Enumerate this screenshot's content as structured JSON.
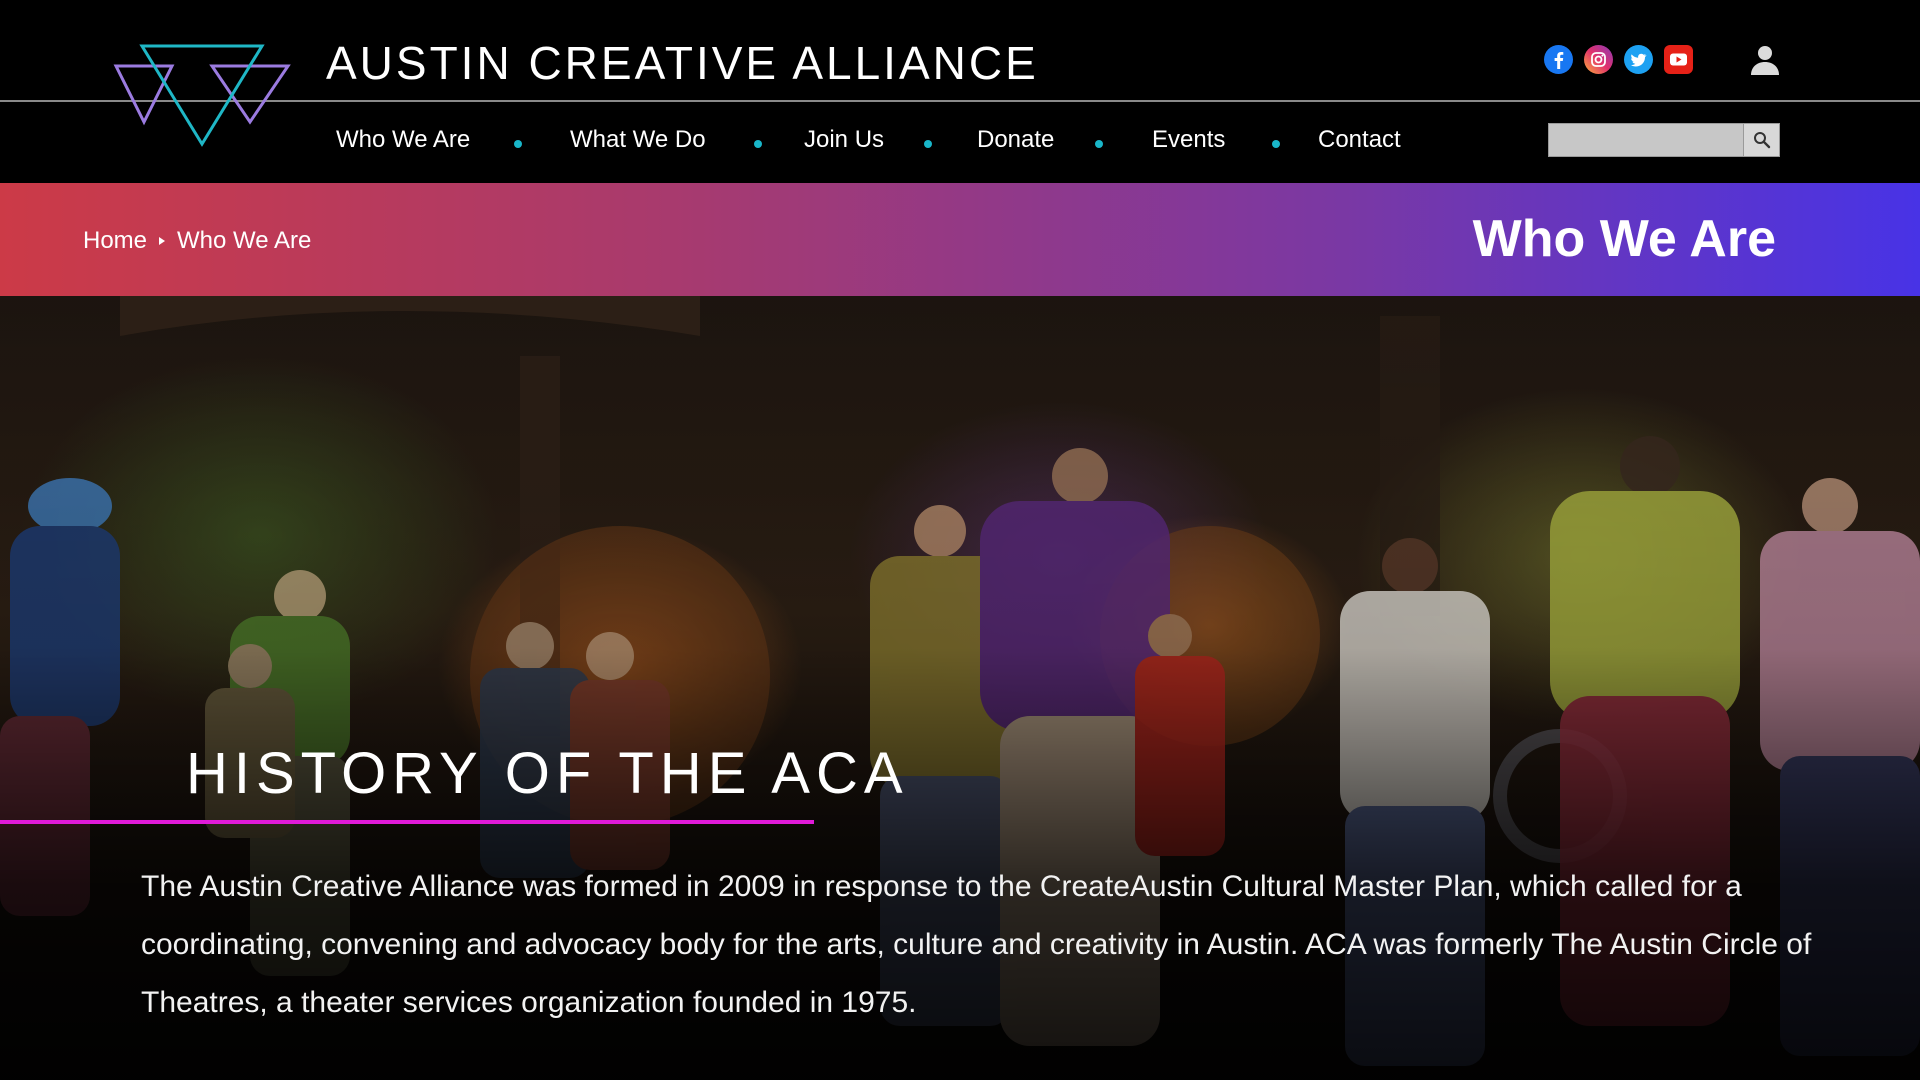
{
  "site": {
    "title": "AUSTIN CREATIVE ALLIANCE",
    "logo_icon": "aca-triangles-logo"
  },
  "social": [
    {
      "name": "facebook-icon",
      "color": "#1877f2"
    },
    {
      "name": "instagram-icon",
      "color": "#d6249f"
    },
    {
      "name": "twitter-icon",
      "color": "#1da1f2"
    },
    {
      "name": "youtube-icon",
      "color": "#e62117"
    }
  ],
  "nav": {
    "items": [
      {
        "label": "Who We Are"
      },
      {
        "label": "What We Do"
      },
      {
        "label": "Join Us"
      },
      {
        "label": "Donate"
      },
      {
        "label": "Events"
      },
      {
        "label": "Contact"
      }
    ],
    "dot_color": "#19b6c9"
  },
  "search": {
    "value": "",
    "placeholder": "",
    "button_icon": "magnifier-icon"
  },
  "banner": {
    "breadcrumb": {
      "home": "Home",
      "current": "Who We Are"
    },
    "title": "Who We Are",
    "gradient": [
      "#cc3a47",
      "#7a38a4",
      "#4833e6"
    ]
  },
  "hero": {
    "heading": "HISTORY OF THE ACA",
    "accent_color": "#e01ad8",
    "paragraph": "The Austin Creative Alliance was formed in 2009 in response to the CreateAustin Cultural Master Plan, which called for a coordinating, convening and advocacy body for the arts, culture and creativity in Austin. ACA was formerly The Austin Circle of Theatres, a theater services organization founded in 1975."
  }
}
